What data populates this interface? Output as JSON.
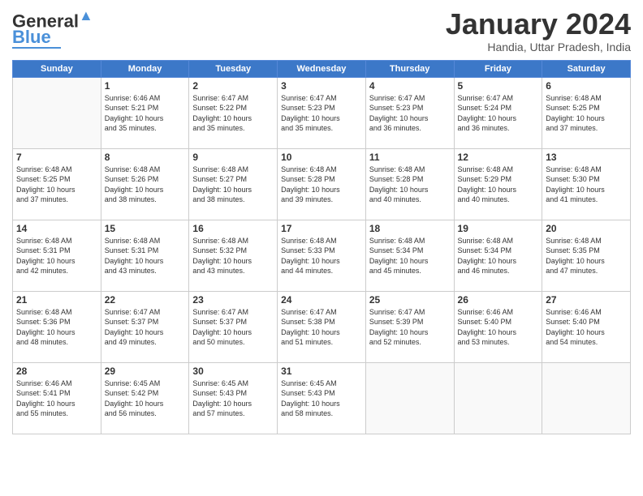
{
  "logo": {
    "line1": "General",
    "line2": "Blue"
  },
  "header": {
    "month": "January 2024",
    "location": "Handia, Uttar Pradesh, India"
  },
  "weekdays": [
    "Sunday",
    "Monday",
    "Tuesday",
    "Wednesday",
    "Thursday",
    "Friday",
    "Saturday"
  ],
  "weeks": [
    [
      {
        "day": null,
        "info": null
      },
      {
        "day": "1",
        "info": "Sunrise: 6:46 AM\nSunset: 5:21 PM\nDaylight: 10 hours\nand 35 minutes."
      },
      {
        "day": "2",
        "info": "Sunrise: 6:47 AM\nSunset: 5:22 PM\nDaylight: 10 hours\nand 35 minutes."
      },
      {
        "day": "3",
        "info": "Sunrise: 6:47 AM\nSunset: 5:23 PM\nDaylight: 10 hours\nand 35 minutes."
      },
      {
        "day": "4",
        "info": "Sunrise: 6:47 AM\nSunset: 5:23 PM\nDaylight: 10 hours\nand 36 minutes."
      },
      {
        "day": "5",
        "info": "Sunrise: 6:47 AM\nSunset: 5:24 PM\nDaylight: 10 hours\nand 36 minutes."
      },
      {
        "day": "6",
        "info": "Sunrise: 6:48 AM\nSunset: 5:25 PM\nDaylight: 10 hours\nand 37 minutes."
      }
    ],
    [
      {
        "day": "7",
        "info": "Sunrise: 6:48 AM\nSunset: 5:25 PM\nDaylight: 10 hours\nand 37 minutes."
      },
      {
        "day": "8",
        "info": "Sunrise: 6:48 AM\nSunset: 5:26 PM\nDaylight: 10 hours\nand 38 minutes."
      },
      {
        "day": "9",
        "info": "Sunrise: 6:48 AM\nSunset: 5:27 PM\nDaylight: 10 hours\nand 38 minutes."
      },
      {
        "day": "10",
        "info": "Sunrise: 6:48 AM\nSunset: 5:28 PM\nDaylight: 10 hours\nand 39 minutes."
      },
      {
        "day": "11",
        "info": "Sunrise: 6:48 AM\nSunset: 5:28 PM\nDaylight: 10 hours\nand 40 minutes."
      },
      {
        "day": "12",
        "info": "Sunrise: 6:48 AM\nSunset: 5:29 PM\nDaylight: 10 hours\nand 40 minutes."
      },
      {
        "day": "13",
        "info": "Sunrise: 6:48 AM\nSunset: 5:30 PM\nDaylight: 10 hours\nand 41 minutes."
      }
    ],
    [
      {
        "day": "14",
        "info": "Sunrise: 6:48 AM\nSunset: 5:31 PM\nDaylight: 10 hours\nand 42 minutes."
      },
      {
        "day": "15",
        "info": "Sunrise: 6:48 AM\nSunset: 5:31 PM\nDaylight: 10 hours\nand 43 minutes."
      },
      {
        "day": "16",
        "info": "Sunrise: 6:48 AM\nSunset: 5:32 PM\nDaylight: 10 hours\nand 43 minutes."
      },
      {
        "day": "17",
        "info": "Sunrise: 6:48 AM\nSunset: 5:33 PM\nDaylight: 10 hours\nand 44 minutes."
      },
      {
        "day": "18",
        "info": "Sunrise: 6:48 AM\nSunset: 5:34 PM\nDaylight: 10 hours\nand 45 minutes."
      },
      {
        "day": "19",
        "info": "Sunrise: 6:48 AM\nSunset: 5:34 PM\nDaylight: 10 hours\nand 46 minutes."
      },
      {
        "day": "20",
        "info": "Sunrise: 6:48 AM\nSunset: 5:35 PM\nDaylight: 10 hours\nand 47 minutes."
      }
    ],
    [
      {
        "day": "21",
        "info": "Sunrise: 6:48 AM\nSunset: 5:36 PM\nDaylight: 10 hours\nand 48 minutes."
      },
      {
        "day": "22",
        "info": "Sunrise: 6:47 AM\nSunset: 5:37 PM\nDaylight: 10 hours\nand 49 minutes."
      },
      {
        "day": "23",
        "info": "Sunrise: 6:47 AM\nSunset: 5:37 PM\nDaylight: 10 hours\nand 50 minutes."
      },
      {
        "day": "24",
        "info": "Sunrise: 6:47 AM\nSunset: 5:38 PM\nDaylight: 10 hours\nand 51 minutes."
      },
      {
        "day": "25",
        "info": "Sunrise: 6:47 AM\nSunset: 5:39 PM\nDaylight: 10 hours\nand 52 minutes."
      },
      {
        "day": "26",
        "info": "Sunrise: 6:46 AM\nSunset: 5:40 PM\nDaylight: 10 hours\nand 53 minutes."
      },
      {
        "day": "27",
        "info": "Sunrise: 6:46 AM\nSunset: 5:40 PM\nDaylight: 10 hours\nand 54 minutes."
      }
    ],
    [
      {
        "day": "28",
        "info": "Sunrise: 6:46 AM\nSunset: 5:41 PM\nDaylight: 10 hours\nand 55 minutes."
      },
      {
        "day": "29",
        "info": "Sunrise: 6:45 AM\nSunset: 5:42 PM\nDaylight: 10 hours\nand 56 minutes."
      },
      {
        "day": "30",
        "info": "Sunrise: 6:45 AM\nSunset: 5:43 PM\nDaylight: 10 hours\nand 57 minutes."
      },
      {
        "day": "31",
        "info": "Sunrise: 6:45 AM\nSunset: 5:43 PM\nDaylight: 10 hours\nand 58 minutes."
      },
      {
        "day": null,
        "info": null
      },
      {
        "day": null,
        "info": null
      },
      {
        "day": null,
        "info": null
      }
    ]
  ]
}
